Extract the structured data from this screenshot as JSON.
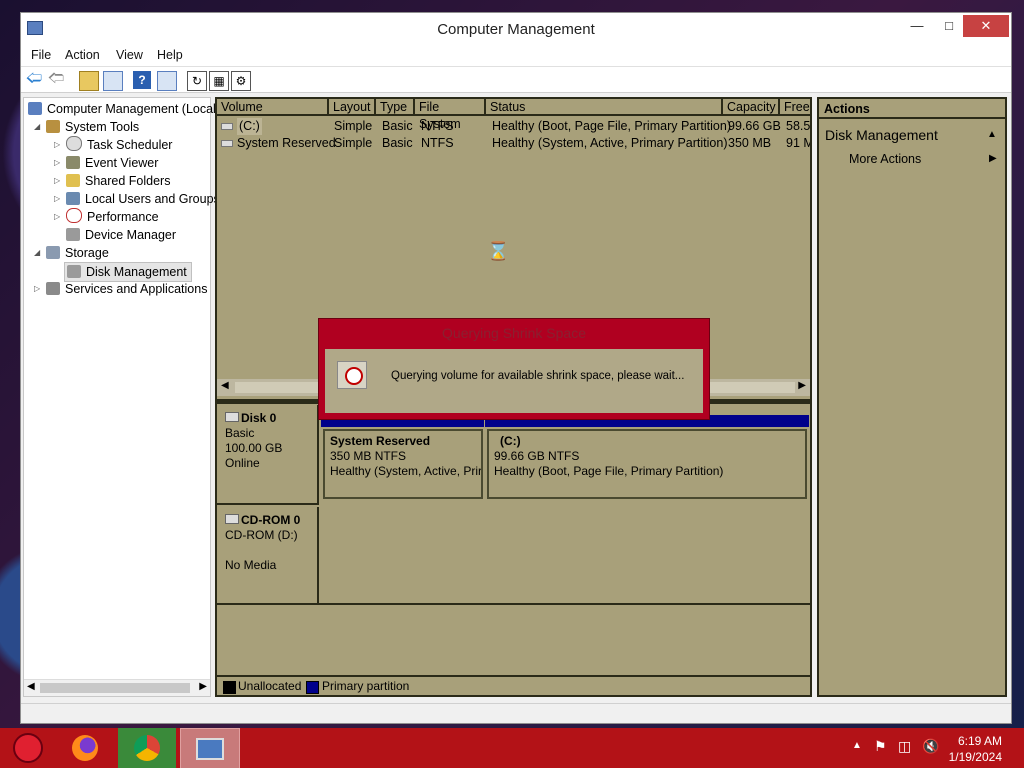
{
  "window": {
    "title": "Computer Management"
  },
  "menu": [
    "File",
    "Action",
    "View",
    "Help"
  ],
  "tree": {
    "root": "Computer Management (Local",
    "system_tools": "System Tools",
    "task_scheduler": "Task Scheduler",
    "event_viewer": "Event Viewer",
    "shared_folders": "Shared Folders",
    "local_users": "Local Users and Groups",
    "performance": "Performance",
    "device_manager": "Device Manager",
    "storage": "Storage",
    "disk_management": "Disk Management",
    "services": "Services and Applications"
  },
  "volume_list": {
    "columns": [
      "Volume",
      "Layout",
      "Type",
      "File System",
      "Status",
      "Capacity",
      "Free"
    ],
    "rows": [
      [
        "(C:)",
        "Simple",
        "Basic",
        "NTFS",
        "Healthy (Boot, Page File, Primary Partition)",
        "99.66 GB",
        "58.5"
      ],
      [
        "System Reserved",
        "Simple",
        "Basic",
        "NTFS",
        "Healthy (System, Active, Primary Partition)",
        "350 MB",
        "91 M"
      ]
    ]
  },
  "disks": {
    "disk0": {
      "name": "Disk 0",
      "type": "Basic",
      "size": "100.00 GB",
      "state": "Online"
    },
    "cdrom0": {
      "name": "CD-ROM 0",
      "type": "CD-ROM (D:)",
      "state": "No Media"
    }
  },
  "partitions": {
    "reserved": {
      "name": "System Reserved",
      "size": "350 MB NTFS",
      "status": "Healthy (System, Active, Prir"
    },
    "c": {
      "name": "(C:)",
      "size": "99.66 GB NTFS",
      "status": "Healthy (Boot, Page File, Primary Partition)"
    }
  },
  "legend": {
    "unallocated": "Unallocated",
    "primary": "Primary partition"
  },
  "actions": {
    "header": "Actions",
    "section": "Disk Management",
    "more": "More Actions"
  },
  "dialog": {
    "title": "Querying Shrink Space",
    "message": "Querying volume for available shrink space, please wait..."
  },
  "taskbar": {
    "time": "6:19 AM",
    "date": "1/19/2024"
  },
  "colors": {
    "pane": "#a8a07a",
    "primary_partition": "#00008b",
    "taskbar": "#b31217",
    "dialog_frame": "#b00020"
  }
}
